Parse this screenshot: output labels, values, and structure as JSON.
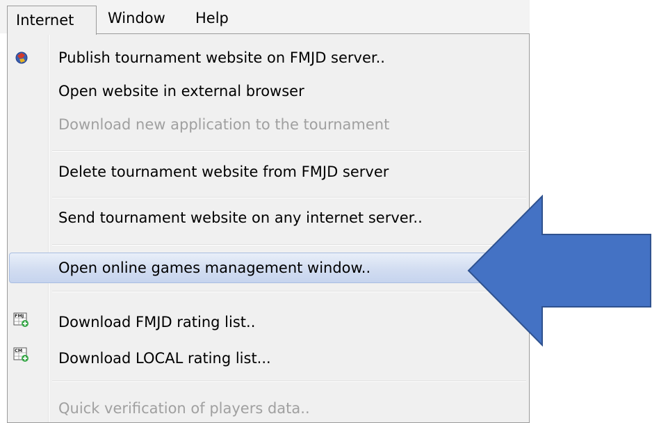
{
  "menubar": {
    "items": [
      {
        "label": "Internet",
        "active": true
      },
      {
        "label": "Window"
      },
      {
        "label": "Help"
      }
    ]
  },
  "menu": {
    "items": [
      {
        "label": "Publish tournament website on FMJD server..",
        "icon": "globe-icon"
      },
      {
        "label": "Open website in external browser"
      },
      {
        "label": "Download new application to the tournament",
        "disabled": true
      },
      {
        "label": "Delete tournament website from FMJD server"
      },
      {
        "label": "Send tournament website on any internet server.."
      },
      {
        "label": "Open online games management window..",
        "highlighted": true
      },
      {
        "label": "Download FMJD rating list..",
        "icon": "fmj-rating-download-icon",
        "icon_text": "FMJ"
      },
      {
        "label": "Download LOCAL rating list...",
        "icon": "cm-rating-download-icon",
        "icon_text": "CM"
      },
      {
        "label": "Quick verification of players data..",
        "disabled": true
      }
    ]
  },
  "annotation": {
    "arrow_color": "#4472c4",
    "arrow_border": "#2f528f"
  }
}
